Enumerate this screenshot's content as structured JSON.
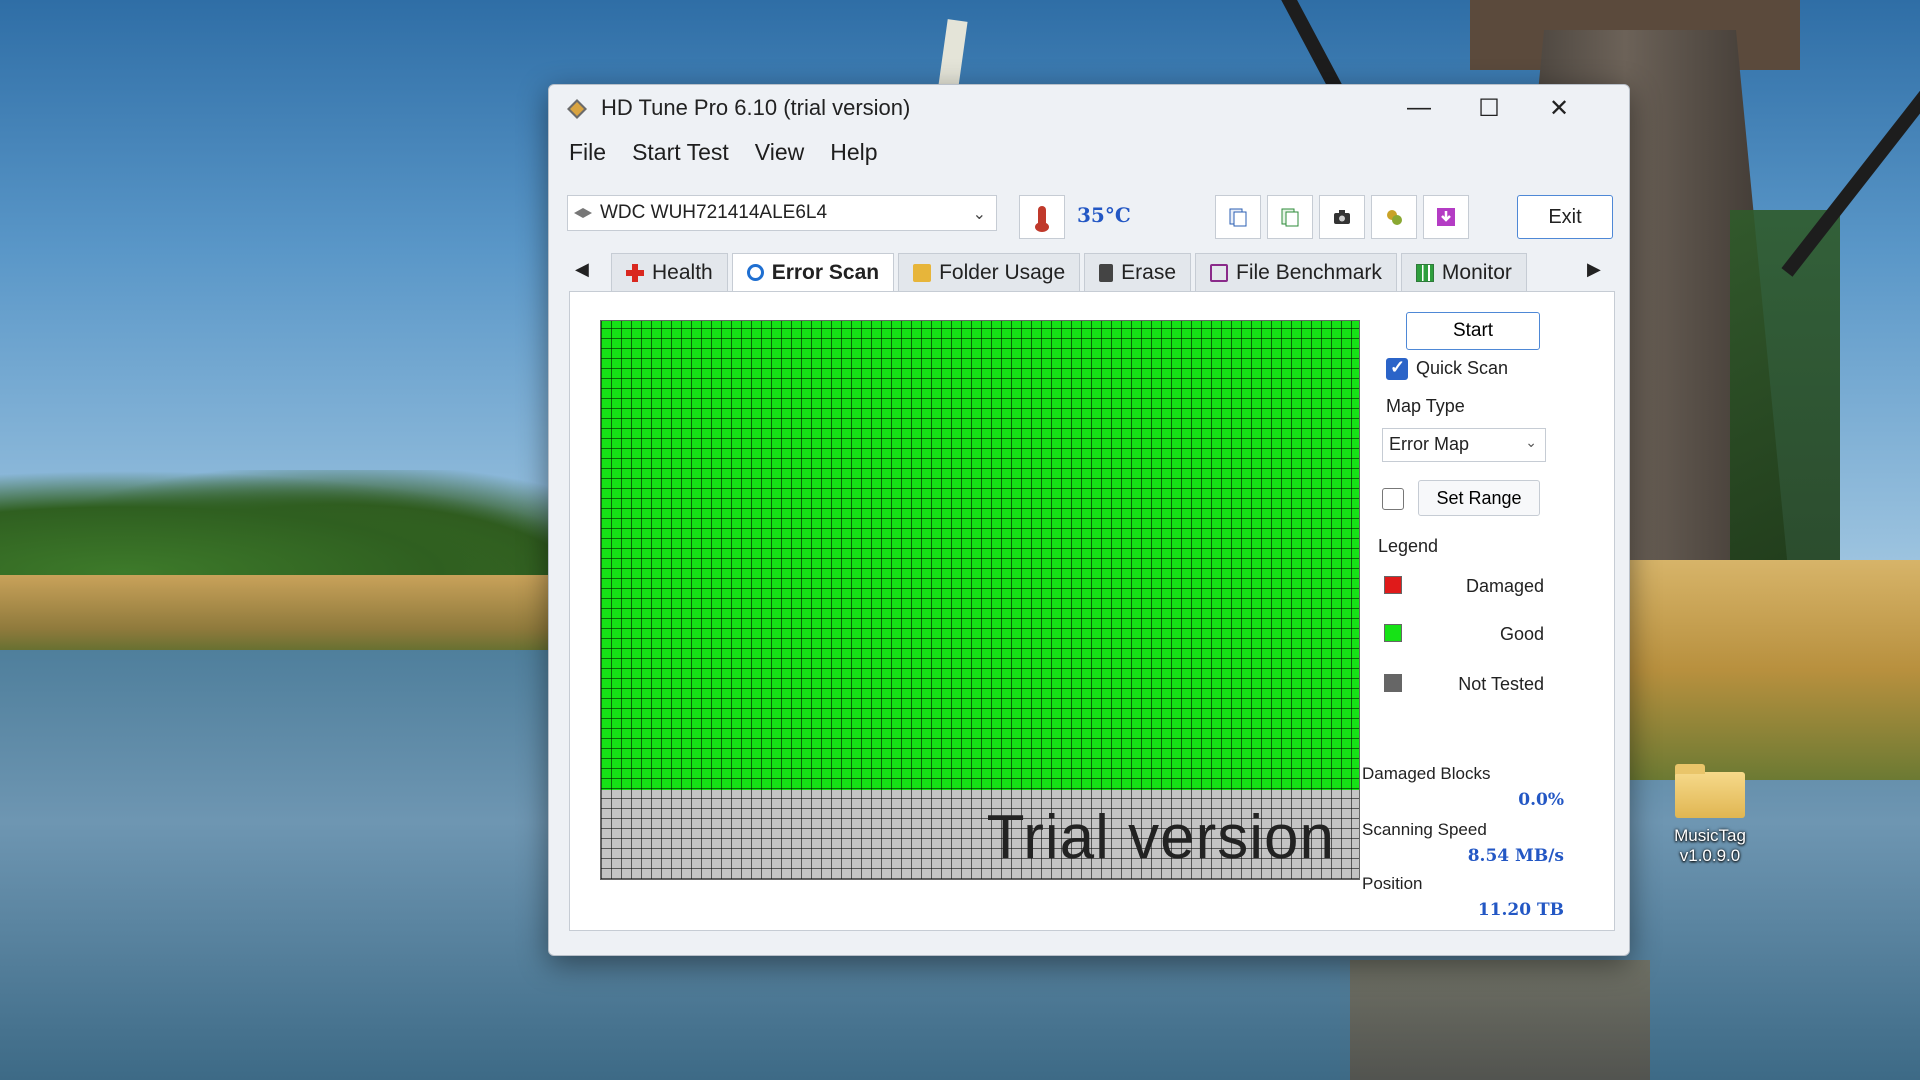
{
  "window": {
    "title": "HD Tune Pro 6.10 (trial version)",
    "controls": {
      "minimize": "—",
      "maximize": "☐",
      "close": "✕"
    }
  },
  "menu": [
    "File",
    "Start Test",
    "View",
    "Help"
  ],
  "toolbar": {
    "drive": "WDC  WUH721414ALE6L4",
    "temperature": "35°C",
    "exit_label": "Exit",
    "tool_icons": [
      "copy-info-icon",
      "save-info-icon",
      "screenshot-icon",
      "options-icon",
      "download-icon"
    ]
  },
  "tabs": [
    {
      "label": "Health",
      "icon": "health-icon",
      "active": false
    },
    {
      "label": "Error Scan",
      "icon": "search-icon",
      "active": true
    },
    {
      "label": "Folder Usage",
      "icon": "folder-icon",
      "active": false
    },
    {
      "label": "Erase",
      "icon": "erase-icon",
      "active": false
    },
    {
      "label": "File Benchmark",
      "icon": "benchmark-icon",
      "active": false
    },
    {
      "label": "Monitor",
      "icon": "monitor-icon",
      "active": false
    }
  ],
  "scan": {
    "start_label": "Start",
    "quick_scan_label": "Quick Scan",
    "quick_scan_checked": true,
    "map_type_label": "Map Type",
    "map_type_value": "Error Map",
    "set_range_label": "Set Range",
    "set_range_checked": false,
    "legend_label": "Legend",
    "legend": [
      {
        "label": "Damaged",
        "color": "#e01a1a"
      },
      {
        "label": "Good",
        "color": "#16e216"
      },
      {
        "label": "Not Tested",
        "color": "#666666"
      }
    ],
    "tested_fraction": 0.84,
    "watermark": "Trial version",
    "damaged_blocks_label": "Damaged Blocks",
    "damaged_blocks_value": "0.0%",
    "scanning_speed_label": "Scanning Speed",
    "scanning_speed_value": "8.54 MB/s",
    "position_label": "Position",
    "position_value": "11.20 TB"
  },
  "desktop": {
    "icon_label": "MusicTag v1.0.9.0"
  }
}
